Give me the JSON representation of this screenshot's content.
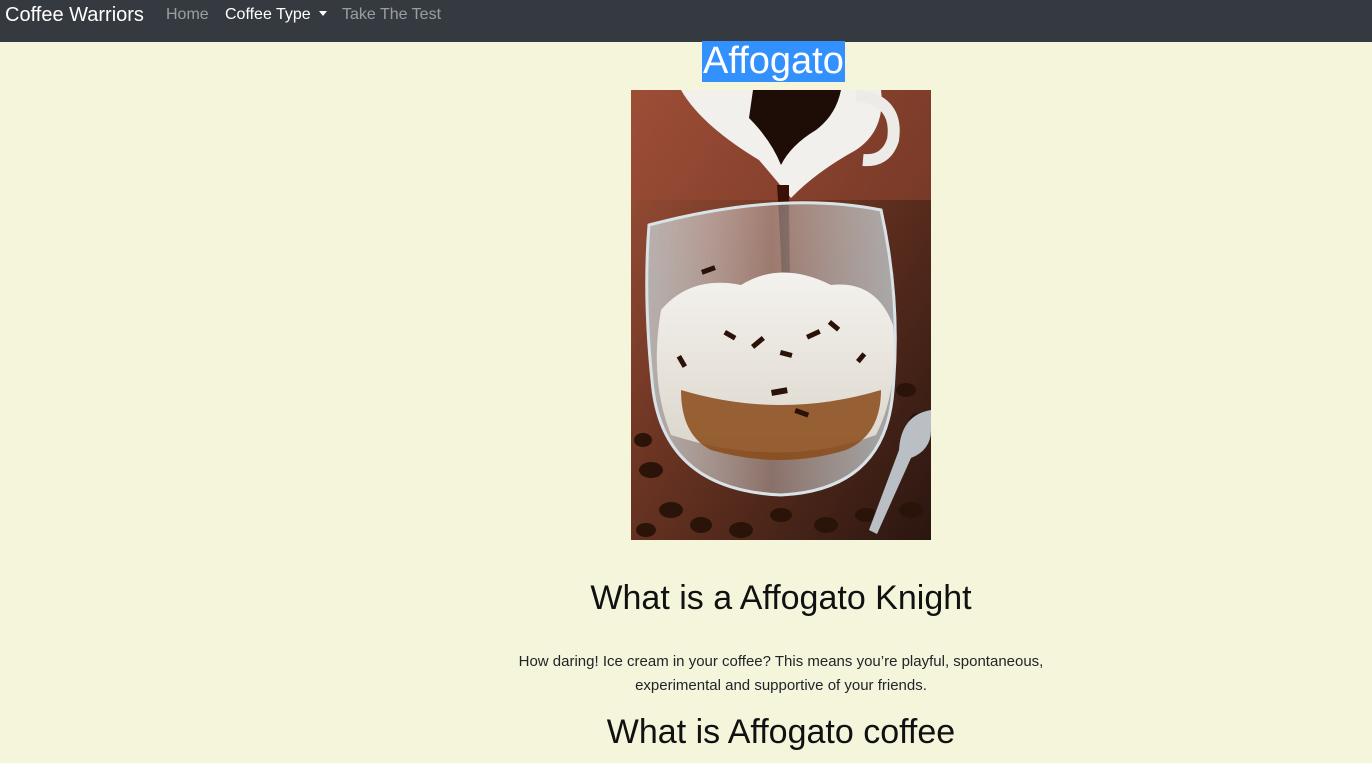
{
  "navbar": {
    "brand": "Coffee Warriors",
    "links": {
      "home": "Home",
      "coffee_type": "Coffee Type",
      "take_test": "Take The Test"
    },
    "background": "#343a40"
  },
  "page": {
    "title": "Affogato",
    "image": {
      "alt": "Affogato",
      "icon": "affogato-photo"
    },
    "knight_heading": "What is a Affogato Knight",
    "description": "How daring! Ice cream in your coffee? This means you’re playful, spontaneous, experimental and supportive of your friends.",
    "coffee_heading": "What is Affogato coffee"
  },
  "colors": {
    "page_background": "#f5f5dc",
    "selection_highlight": "#3390ff"
  }
}
